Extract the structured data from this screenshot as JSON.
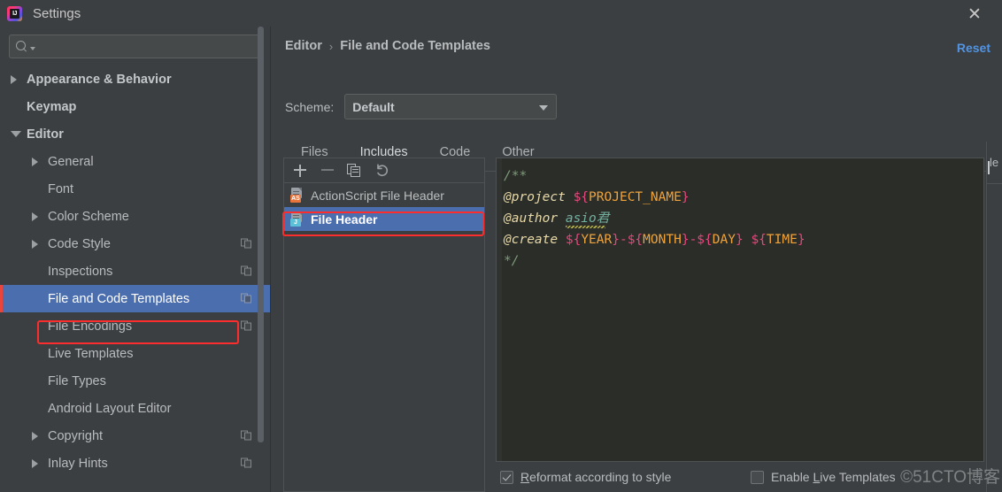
{
  "window": {
    "title": "Settings",
    "logo_text": "IJ",
    "close_label": "✕"
  },
  "sidebar": {
    "search": {
      "value": "",
      "placeholder": ""
    },
    "items": [
      {
        "label": "Appearance & Behavior",
        "arrow": "right",
        "indent": 0,
        "bold": true,
        "selected": false,
        "copy": false
      },
      {
        "label": "Keymap",
        "arrow": "none",
        "indent": 0,
        "bold": true,
        "selected": false,
        "copy": false
      },
      {
        "label": "Editor",
        "arrow": "down",
        "indent": 0,
        "bold": true,
        "selected": false,
        "copy": false
      },
      {
        "label": "General",
        "arrow": "right",
        "indent": 1,
        "bold": false,
        "selected": false,
        "copy": false
      },
      {
        "label": "Font",
        "arrow": "none",
        "indent": 1,
        "bold": false,
        "selected": false,
        "copy": false
      },
      {
        "label": "Color Scheme",
        "arrow": "right",
        "indent": 1,
        "bold": false,
        "selected": false,
        "copy": false
      },
      {
        "label": "Code Style",
        "arrow": "right",
        "indent": 1,
        "bold": false,
        "selected": false,
        "copy": true
      },
      {
        "label": "Inspections",
        "arrow": "none",
        "indent": 1,
        "bold": false,
        "selected": false,
        "copy": true
      },
      {
        "label": "File and Code Templates",
        "arrow": "none",
        "indent": 1,
        "bold": false,
        "selected": true,
        "copy": true
      },
      {
        "label": "File Encodings",
        "arrow": "none",
        "indent": 1,
        "bold": false,
        "selected": false,
        "copy": true
      },
      {
        "label": "Live Templates",
        "arrow": "none",
        "indent": 1,
        "bold": false,
        "selected": false,
        "copy": false
      },
      {
        "label": "File Types",
        "arrow": "none",
        "indent": 1,
        "bold": false,
        "selected": false,
        "copy": false
      },
      {
        "label": "Android Layout Editor",
        "arrow": "none",
        "indent": 1,
        "bold": false,
        "selected": false,
        "copy": false
      },
      {
        "label": "Copyright",
        "arrow": "right",
        "indent": 1,
        "bold": false,
        "selected": false,
        "copy": true
      },
      {
        "label": "Inlay Hints",
        "arrow": "right",
        "indent": 1,
        "bold": false,
        "selected": false,
        "copy": true
      }
    ]
  },
  "main": {
    "breadcrumb": {
      "parent": "Editor",
      "separator": "›",
      "current": "File and Code Templates"
    },
    "reset_label": "Reset",
    "scheme": {
      "label": "Scheme:",
      "value": "Default"
    },
    "tabs": [
      {
        "label": "Files",
        "active": false
      },
      {
        "label": "Includes",
        "active": true
      },
      {
        "label": "Code",
        "active": false
      },
      {
        "label": "Other",
        "active": false
      }
    ],
    "list_toolbar": [
      {
        "name": "add",
        "glyph": "+"
      },
      {
        "name": "remove",
        "glyph": "−"
      },
      {
        "name": "copy",
        "glyph": "⧉"
      },
      {
        "name": "revert",
        "glyph": "↶"
      }
    ],
    "templates": [
      {
        "name": "ActionScript File Header",
        "badge": "AS",
        "badge_color": "#e8743b",
        "selected": false
      },
      {
        "name": "File Header",
        "badge": "J",
        "badge_color": "#5cc0d8",
        "selected": true
      }
    ],
    "editor": {
      "lines": [
        {
          "type": "comment",
          "text": "/**"
        },
        {
          "type": "project",
          "tag": "@project",
          "var": "${PROJECT_NAME}"
        },
        {
          "type": "author",
          "tag": "@author",
          "value": "asio君"
        },
        {
          "type": "create",
          "tag": "@create",
          "vars": "${YEAR}-${MONTH}-${DAY} ${TIME}"
        },
        {
          "type": "comment",
          "text": "*/"
        }
      ],
      "raw": "/**\n@project ${PROJECT_NAME}\n@author asio君\n@create ${YEAR}-${MONTH}-${DAY} ${TIME}\n*/"
    },
    "checkboxes": [
      {
        "label_pre": "",
        "mnemonic": "R",
        "label_post": "eformat according to style",
        "checked": true
      },
      {
        "label_pre": "Enable ",
        "mnemonic": "L",
        "label_post": "ive Templates",
        "checked": false
      }
    ],
    "right_panel_text": "le"
  },
  "watermark": "©51CTO博客",
  "colors": {
    "accent_selection": "#4b6eaf",
    "link": "#5294e2",
    "highlight_box": "#fc2d2d",
    "panel_bg": "#3c3f41",
    "editor_bg": "#2b2d29"
  }
}
